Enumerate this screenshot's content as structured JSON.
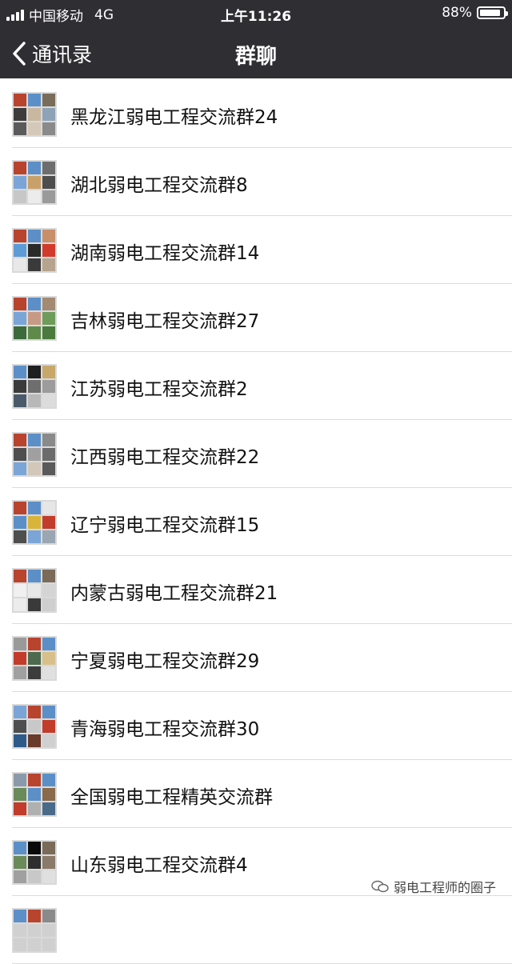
{
  "status_bar": {
    "carrier": "中国移动",
    "network": "4G",
    "time": "上午11:26",
    "battery_percent": "88%",
    "battery_level": 0.88
  },
  "nav": {
    "back_label": "通讯录",
    "title": "群聊"
  },
  "groups": [
    {
      "name": "黑龙江弱电工程交流群24",
      "avatar_colors": [
        "#b9442e",
        "#5c8fc7",
        "#7a6c5a",
        "#3c3c3c",
        "#c8b8a0",
        "#8fa3b8",
        "#5a5a5a",
        "#d4c9b8",
        "#8a8a8a"
      ]
    },
    {
      "name": "湖北弱电工程交流群8",
      "avatar_colors": [
        "#b9442e",
        "#5c8fc7",
        "#6d6d6d",
        "#7aa5d6",
        "#c9a06a",
        "#4e4e4e",
        "#c7c7c7",
        "#ececec",
        "#9a9a9a"
      ]
    },
    {
      "name": "湖南弱电工程交流群14",
      "avatar_colors": [
        "#b9442e",
        "#5c8fc7",
        "#c98f6b",
        "#5d9bd6",
        "#2a2a2a",
        "#d23b2b",
        "#e8e8e8",
        "#3a3a3a",
        "#b7a48d"
      ]
    },
    {
      "name": "吉林弱电工程交流群27",
      "avatar_colors": [
        "#b9442e",
        "#5c8fc7",
        "#a38a72",
        "#7aa5d6",
        "#c79a86",
        "#6e9c5b",
        "#3c6a3a",
        "#5f8a4a",
        "#4a7a3c"
      ]
    },
    {
      "name": "江苏弱电工程交流群2",
      "avatar_colors": [
        "#5c8fc7",
        "#1f1f1f",
        "#c7a86a",
        "#3b3b3b",
        "#6e6e6e",
        "#9c9c9c",
        "#4a5a6a",
        "#b8b8b8",
        "#dcdcdc"
      ]
    },
    {
      "name": "江西弱电工程交流群22",
      "avatar_colors": [
        "#b9442e",
        "#5c8fc7",
        "#8a8a8a",
        "#4e4e4e",
        "#a0a0a0",
        "#6b6b6b",
        "#7aa5d6",
        "#d2c7b8",
        "#5a5a5a"
      ]
    },
    {
      "name": "辽宁弱电工程交流群15",
      "avatar_colors": [
        "#b9442e",
        "#5c8fc7",
        "#e6e6e6",
        "#5c8fc7",
        "#d9b43a",
        "#c23b2b",
        "#4e4e4e",
        "#7aa5d6",
        "#9aa6b2"
      ]
    },
    {
      "name": "内蒙古弱电工程交流群21",
      "avatar_colors": [
        "#b9442e",
        "#5c8fc7",
        "#7a6a5a",
        "#f0f0f0",
        "#e8e8e8",
        "#d4d4d4",
        "#ececec",
        "#3a3a3a",
        "#cfcfcf"
      ]
    },
    {
      "name": "宁夏弱电工程交流群29",
      "avatar_colors": [
        "#9a9a9a",
        "#b9442e",
        "#5c8fc7",
        "#c23b2b",
        "#4e6a4e",
        "#d9c08a",
        "#a0a0a0",
        "#3c3c3c",
        "#e0e0e0"
      ]
    },
    {
      "name": "青海弱电工程交流群30",
      "avatar_colors": [
        "#7aa5d6",
        "#b9442e",
        "#5c8fc7",
        "#4e4e4e",
        "#c8c8c8",
        "#c23b2b",
        "#2e5a8a",
        "#6a3a2a",
        "#d0d0d0"
      ]
    },
    {
      "name": "全国弱电工程精英交流群",
      "avatar_colors": [
        "#8a9aaa",
        "#b9442e",
        "#5c8fc7",
        "#6a8a5a",
        "#5c8fc7",
        "#8a6a4a",
        "#c23b2b",
        "#b0b0b0",
        "#4a6a8a"
      ]
    },
    {
      "name": "山东弱电工程交流群4",
      "avatar_colors": [
        "#5c8fc7",
        "#0a0a0a",
        "#7a6a5a",
        "#6a8a5a",
        "#2e2e2e",
        "#8a7a6a",
        "#a0a0a0",
        "#c8c8c8",
        "#e0e0e0"
      ]
    },
    {
      "name": "",
      "avatar_colors": [
        "#5c8fc7",
        "#b9442e",
        "#8a8a8a",
        "#d0d0d0",
        "#d0d0d0",
        "#d0d0d0",
        "#d0d0d0",
        "#d0d0d0",
        "#d0d0d0"
      ]
    }
  ],
  "watermark": {
    "text": "弱电工程师的圈子"
  }
}
